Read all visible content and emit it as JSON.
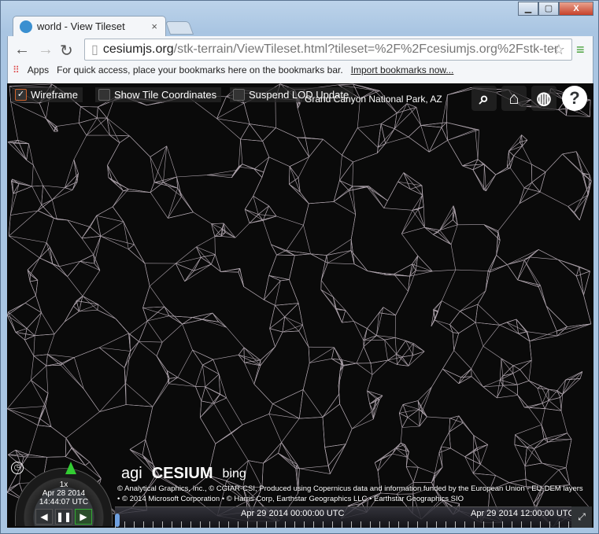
{
  "window": {
    "minimize": "▁",
    "maximize": "▢",
    "close": "X"
  },
  "tab": {
    "title": "world - View Tileset",
    "close": "×"
  },
  "address": {
    "host": "cesiumjs.org",
    "path": "/stk-terrain/ViewTileset.html?tileset=%2F%2Fcesiumjs.org%2Fstk-ter"
  },
  "bookmarks": {
    "apps": "Apps",
    "hint": "For quick access, place your bookmarks here on the bookmarks bar.",
    "import": "Import bookmarks now..."
  },
  "viewer": {
    "options": [
      {
        "label": "Wireframe",
        "checked": true
      },
      {
        "label": "Show Tile Coordinates",
        "checked": false
      },
      {
        "label": "Suspend LOD Update",
        "checked": false
      }
    ],
    "location": "Grand Canyon National Park, AZ",
    "logos": {
      "agi": "agi",
      "cesium": "CESIUM",
      "bing": "bing"
    },
    "credits": [
      "© Analytical Graphics, Inc., © CGIAR-CSI, Produced using Copernicus data and information funded by the European Union - EU-DEM layers",
      "• © 2014 Microsoft Corporation • © Harris Corp, Earthstar Geographics LLC • Earthstar Geographics SIO"
    ],
    "animation": {
      "speed": "1x",
      "date": "Apr 28 2014",
      "time": "14:44:07 UTC"
    },
    "timeline": {
      "labels": [
        "Apr 29 2014 00:00:00 UTC",
        "Apr 29 2014 12:00:00 UTC"
      ]
    },
    "accent": "#d0622a"
  }
}
